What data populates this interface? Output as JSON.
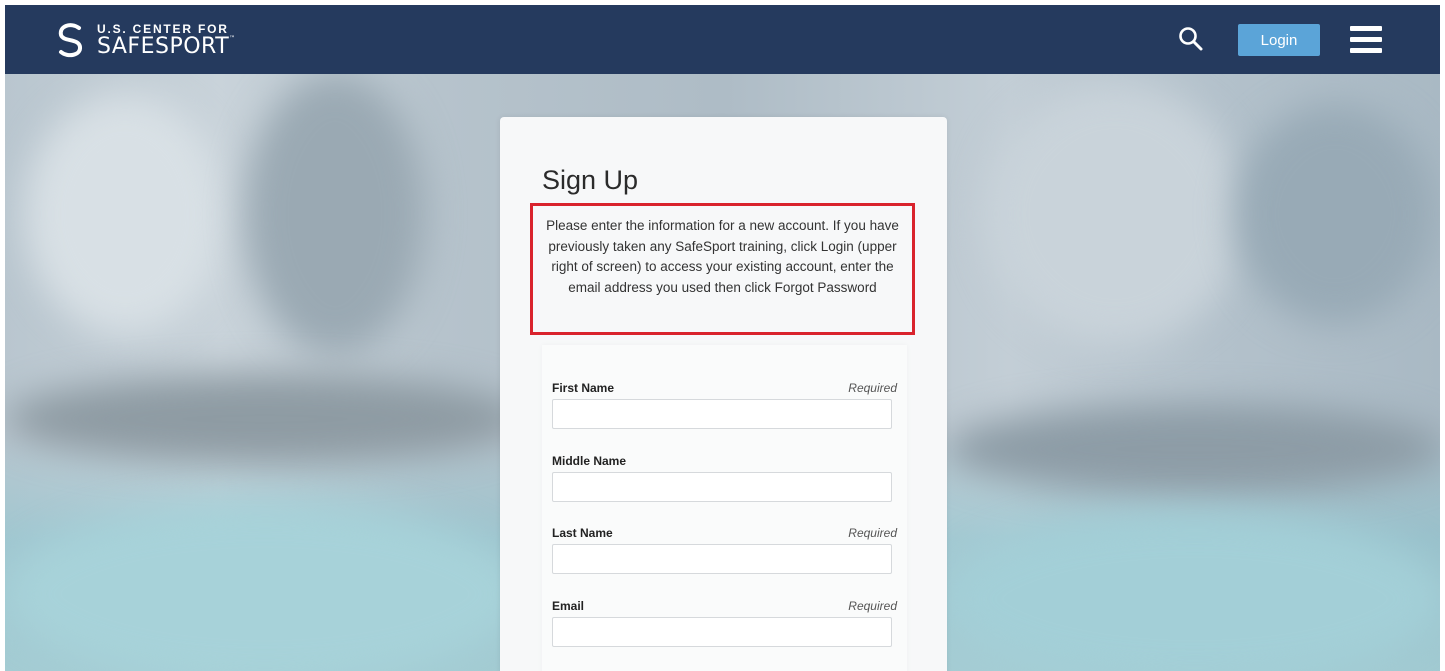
{
  "header": {
    "logo": {
      "line1": "U.S. CENTER FOR",
      "line2": "SAFESPORT",
      "trademark": "™"
    },
    "search_icon": "search-icon",
    "login_label": "Login",
    "menu_icon": "hamburger-menu-icon"
  },
  "colors": {
    "navbar": "#253a5e",
    "login_button": "#5ba4d8",
    "notice_border": "#d9232d"
  },
  "signup": {
    "title": "Sign Up",
    "notice": "Please enter the information for a new account. If you have previously taken any SafeSport training, click Login (upper right of screen) to access your existing account, enter the email address you used then click Forgot Password",
    "fields": [
      {
        "label": "First Name",
        "required_label": "Required",
        "value": "",
        "placeholder": ""
      },
      {
        "label": "Middle Name",
        "required_label": "",
        "value": "",
        "placeholder": ""
      },
      {
        "label": "Last Name",
        "required_label": "Required",
        "value": "",
        "placeholder": ""
      },
      {
        "label": "Email",
        "required_label": "Required",
        "value": "",
        "placeholder": ""
      }
    ]
  }
}
